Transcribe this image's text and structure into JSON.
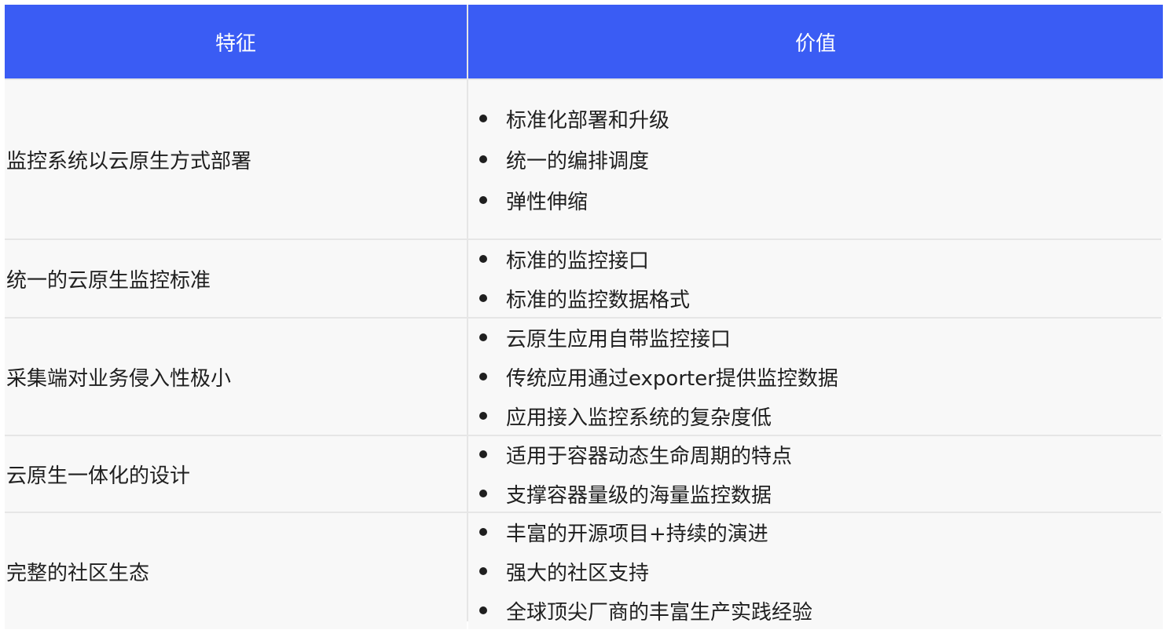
{
  "header": {
    "feature_label": "特征",
    "value_label": "价值"
  },
  "rows": [
    {
      "feature": "监控系统以云原生方式部署",
      "values": [
        "标准化部署和升级",
        "统一的编排调度",
        "弹性伸缩"
      ]
    },
    {
      "feature": "统一的云原生监控标准",
      "values": [
        "标准的监控接口",
        "标准的监控数据格式"
      ]
    },
    {
      "feature": "采集端对业务侵入性极小",
      "values": [
        "云原生应用自带监控接口",
        "传统应用通过exporter提供监控数据",
        "应用接入监控系统的复杂度低"
      ]
    },
    {
      "feature": "云原生一体化的设计",
      "values": [
        "适用于容器动态生命周期的特点",
        "支撑容器量级的海量监控数据"
      ]
    },
    {
      "feature": "完整的社区生态",
      "values": [
        "丰富的开源项目+持续的演进",
        "强大的社区支持",
        "全球顶尖厂商的丰富生产实践经验"
      ]
    }
  ],
  "colors": {
    "header_bg": "#3a5cf4",
    "cell_bg": "#f8f8f8",
    "grid": "#e6e6e6"
  }
}
